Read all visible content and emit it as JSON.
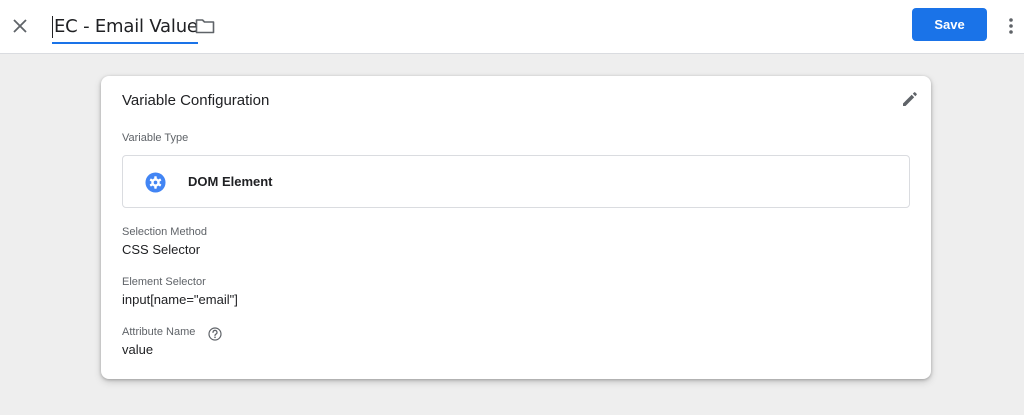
{
  "header": {
    "title": "EC - Email Value",
    "save_label": "Save",
    "icons": {
      "close": "close-icon",
      "folder": "folder-icon",
      "more": "more-vert-icon"
    }
  },
  "card": {
    "title": "Variable Configuration",
    "variable_type_label": "Variable Type",
    "variable_type_value": "DOM Element",
    "selection_method_label": "Selection Method",
    "selection_method_value": "CSS Selector",
    "element_selector_label": "Element Selector",
    "element_selector_value": "input[name=\"email\"]",
    "attribute_name_label": "Attribute Name",
    "attribute_name_value": "value",
    "icons": {
      "edit": "pencil-icon",
      "type": "gear-icon",
      "help": "help-icon"
    }
  },
  "colors": {
    "accent": "#1a73e8",
    "background": "#eeeeee"
  }
}
